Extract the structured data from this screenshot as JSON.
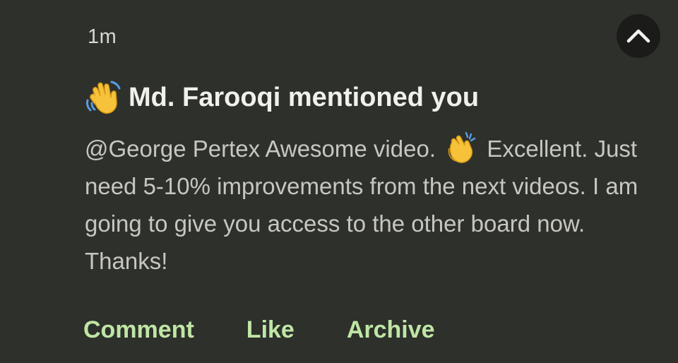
{
  "notification": {
    "timestamp": "1m",
    "title": "Md. Farooqi mentioned you",
    "title_icon": "waving-hand-icon",
    "message_part1": "@George Pertex Awesome video.",
    "message_icon": "clapping-hands-icon",
    "message_part2": "Excellent. Just need 5-10% improvements from the next videos. I am going to give you access to the other board now. Thanks!",
    "collapse_icon": "chevron-up-icon"
  },
  "actions": {
    "comment_label": "Comment",
    "like_label": "Like",
    "archive_label": "Archive"
  },
  "colors": {
    "background": "#2e302b",
    "title": "#f1f1ec",
    "body": "#c7c7c1",
    "action": "#bfe6a5",
    "collapse_button": "#1b1c19"
  }
}
